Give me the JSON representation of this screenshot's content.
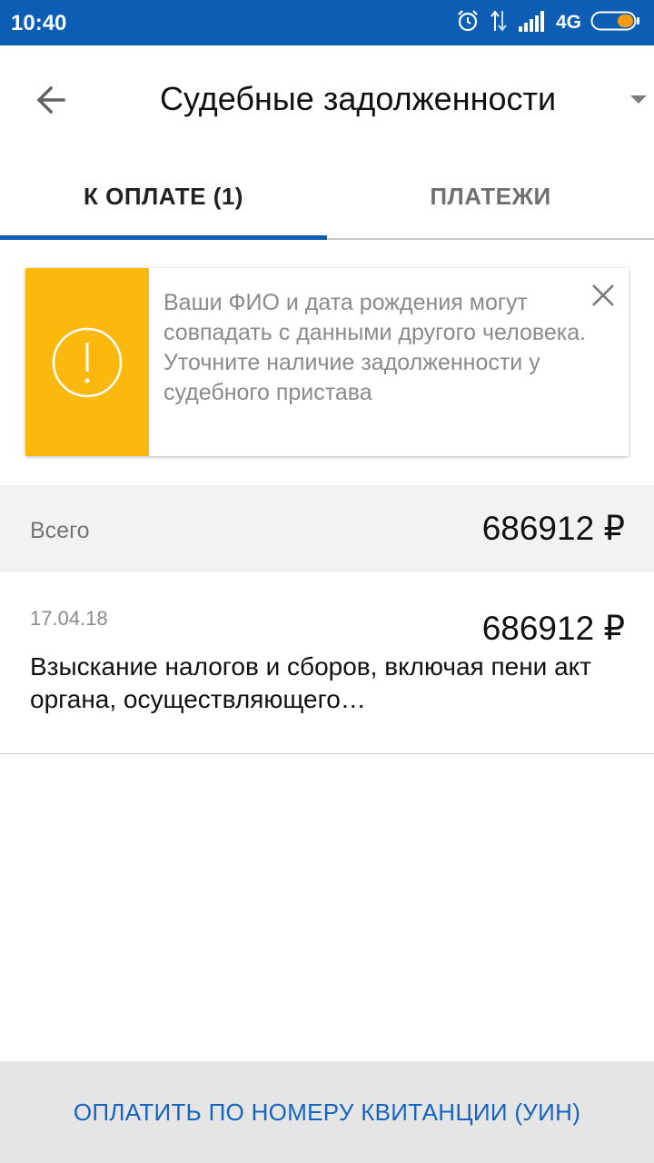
{
  "status_bar": {
    "time": "10:40",
    "network": "4G",
    "icons": [
      "alarm-icon",
      "data-transfer-icon",
      "signal-icon",
      "battery-icon"
    ]
  },
  "toolbar": {
    "title": "Судебные задолженности",
    "back_icon": "arrow-back-icon",
    "dropdown_icon": "triangle-down-icon"
  },
  "tabs": [
    {
      "label": "К ОПЛАТЕ (1)",
      "active": true
    },
    {
      "label": "ПЛАТЕЖИ",
      "active": false
    }
  ],
  "warning": {
    "text": "Ваши ФИО и дата рождения могут совпадать с данными другого человека. Уточните наличие задолженности у судебного пристава",
    "icon": "exclamation-circle-icon",
    "close_icon": "close-icon"
  },
  "total": {
    "label": "Всего",
    "amount": "686912 ₽"
  },
  "debts": [
    {
      "date": "17.04.18",
      "amount": "686912 ₽",
      "description": "Взыскание налогов и сборов, включая пени акт органа, осуществляющего…"
    }
  ],
  "actions": {
    "pay_by_uin": "ОПЛАТИТЬ ПО НОМЕРУ КВИТАНЦИИ (УИН)"
  },
  "colors": {
    "primary": "#0d5db4",
    "warning": "#fbb80d",
    "link": "#1565c0"
  }
}
